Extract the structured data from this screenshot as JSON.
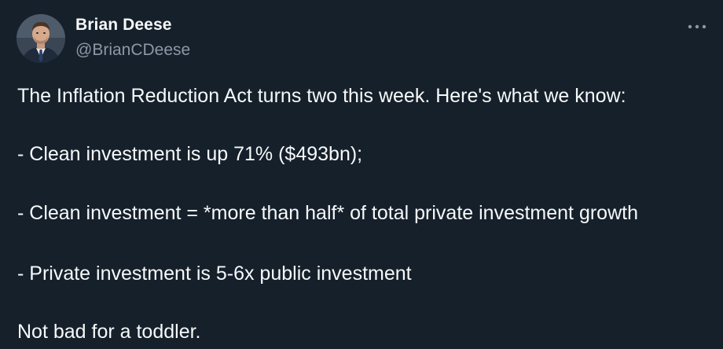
{
  "author": {
    "name": "Brian Deese",
    "handle": "@BrianCDeese"
  },
  "tweet": {
    "lines": [
      "The Inflation Reduction Act turns two this week. Here's what we know:",
      "- Clean investment is up 71% ($493bn);",
      "- Clean investment = *more than half* of total private investment growth",
      "- Private investment is 5-6x public investment",
      "Not bad for a toddler."
    ]
  },
  "icons": {
    "more": "more-options-icon"
  },
  "colors": {
    "background": "#15202b",
    "text": "#f7f9f9",
    "secondary_text": "#8b98a5"
  }
}
